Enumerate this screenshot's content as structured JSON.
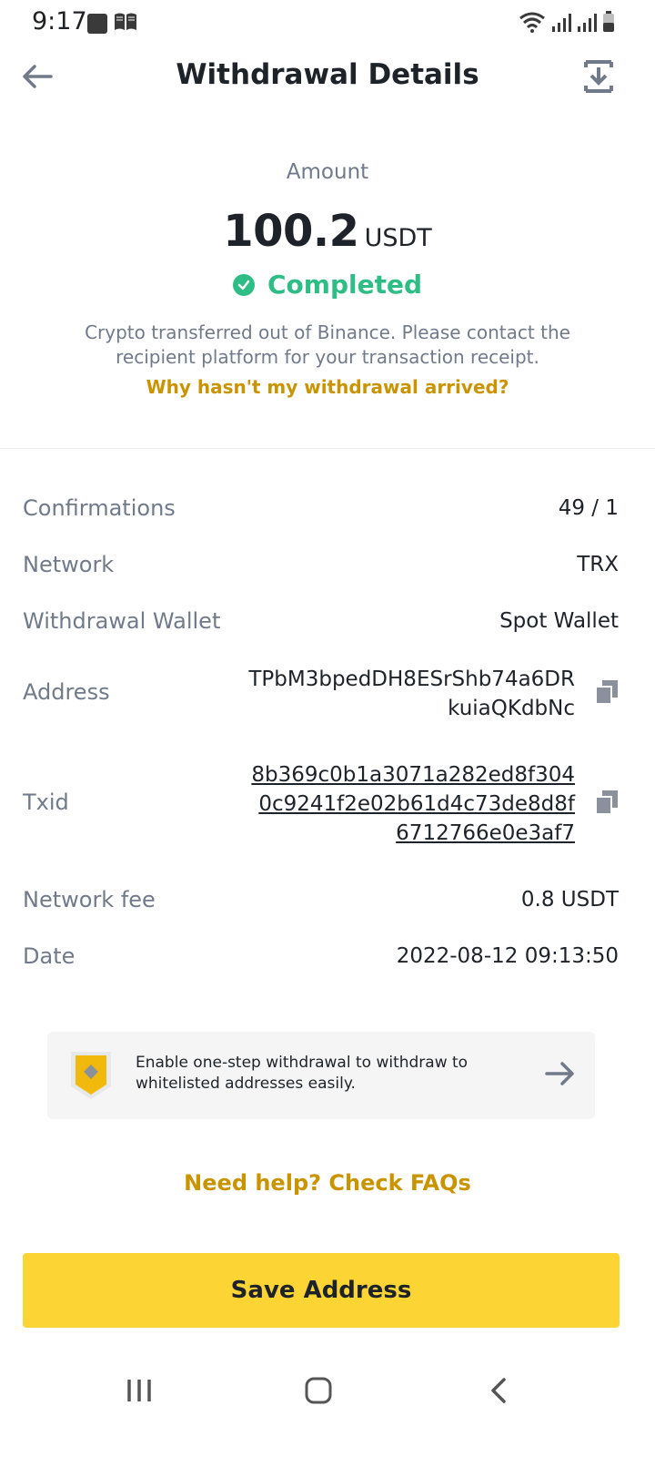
{
  "status_bar": {
    "time": "9:17"
  },
  "header": {
    "title": "Withdrawal Details"
  },
  "summary": {
    "amount_label": "Amount",
    "amount": "100.2",
    "unit": "USDT",
    "status": "Completed",
    "description": "Crypto transferred out of Binance. Please contact the recipient platform for your transaction receipt.",
    "help_link": "Why hasn't my withdrawal arrived?"
  },
  "details": {
    "confirmations": {
      "label": "Confirmations",
      "value": "49 / 1"
    },
    "network": {
      "label": "Network",
      "value": "TRX"
    },
    "wallet": {
      "label": "Withdrawal Wallet",
      "value": "Spot Wallet"
    },
    "address": {
      "label": "Address",
      "value": "TPbM3bpedDH8ESrShb74a6DRkuiaQKdbNc"
    },
    "txid": {
      "label": "Txid",
      "value": "8b369c0b1a3071a282ed8f3040c9241f2e02b61d4c73de8d8f6712766e0e3af7"
    },
    "fee": {
      "label": "Network fee",
      "value": "0.8 USDT"
    },
    "date": {
      "label": "Date",
      "value": "2022-08-12 09:13:50"
    }
  },
  "promo": {
    "text": "Enable one-step withdrawal to withdraw to whitelisted addresses easily."
  },
  "faq_link": "Need help? Check FAQs",
  "save_button": "Save Address",
  "colors": {
    "accent": "#fcd535",
    "success": "#2ebd85",
    "link": "#c99400"
  }
}
